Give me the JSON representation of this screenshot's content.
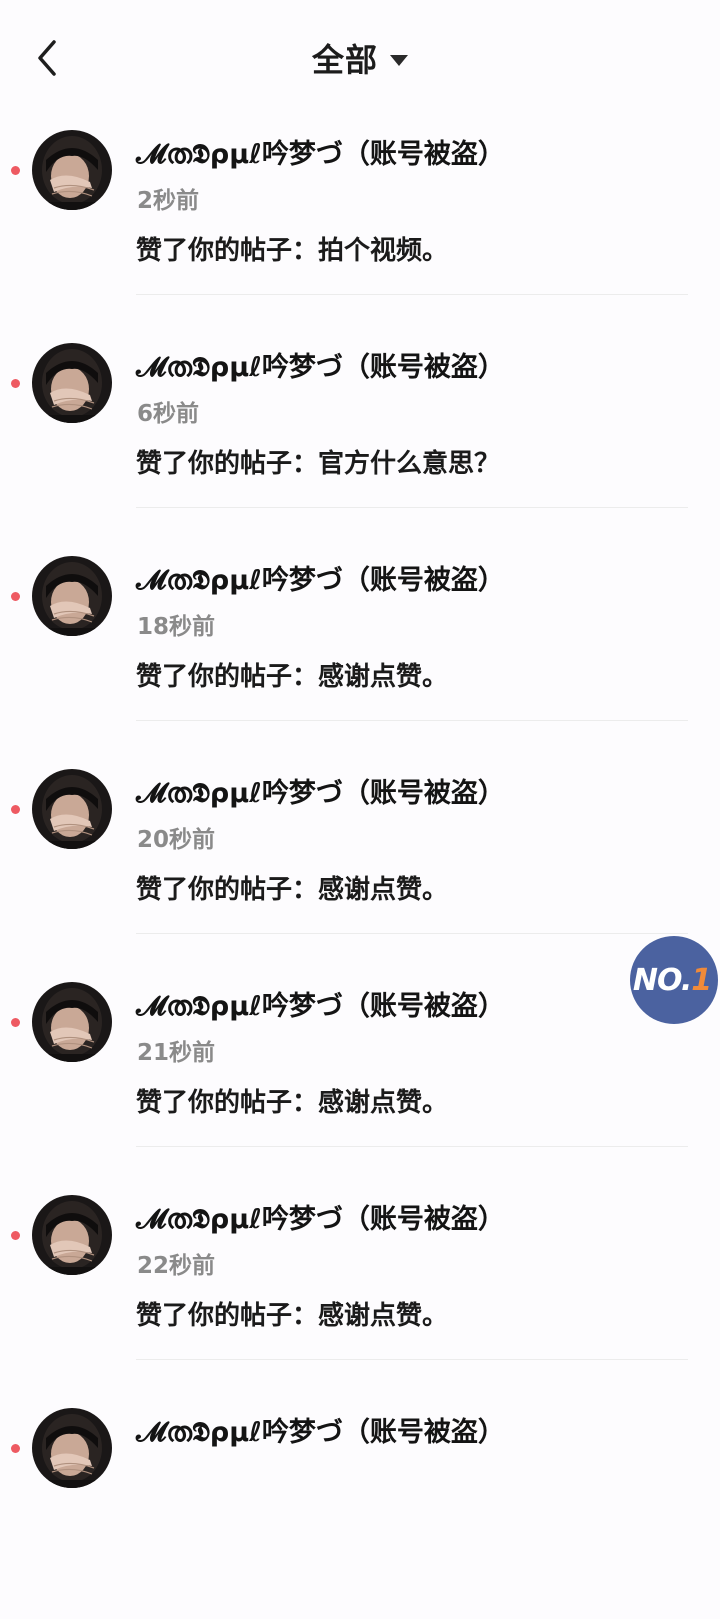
{
  "header": {
    "title": "全部"
  },
  "colors": {
    "unread_dot": "#ee5a62",
    "badge_bg": "#4b62a0",
    "badge_number": "#f08a3a"
  },
  "badge": {
    "prefix": "NO.",
    "number": "1"
  },
  "notifications": [
    {
      "user": "𝓜ത𝕯ρµℓ吟梦づ（账号被盗）",
      "time": "2秒前",
      "message": "赞了你的帖子：拍个视频。"
    },
    {
      "user": "𝓜ത𝕯ρµℓ吟梦づ（账号被盗）",
      "time": "6秒前",
      "message": "赞了你的帖子：官方什么意思？"
    },
    {
      "user": "𝓜ത𝕯ρµℓ吟梦づ（账号被盗）",
      "time": "18秒前",
      "message": "赞了你的帖子：感谢点赞。"
    },
    {
      "user": "𝓜ത𝕯ρµℓ吟梦づ（账号被盗）",
      "time": "20秒前",
      "message": "赞了你的帖子：感谢点赞。"
    },
    {
      "user": "𝓜ത𝕯ρµℓ吟梦づ（账号被盗）",
      "time": "21秒前",
      "message": "赞了你的帖子：感谢点赞。"
    },
    {
      "user": "𝓜ത𝕯ρµℓ吟梦づ（账号被盗）",
      "time": "22秒前",
      "message": "赞了你的帖子：感谢点赞。"
    },
    {
      "user": "𝓜ത𝕯ρµℓ吟梦づ（账号被盗）",
      "time": "",
      "message": ""
    }
  ]
}
